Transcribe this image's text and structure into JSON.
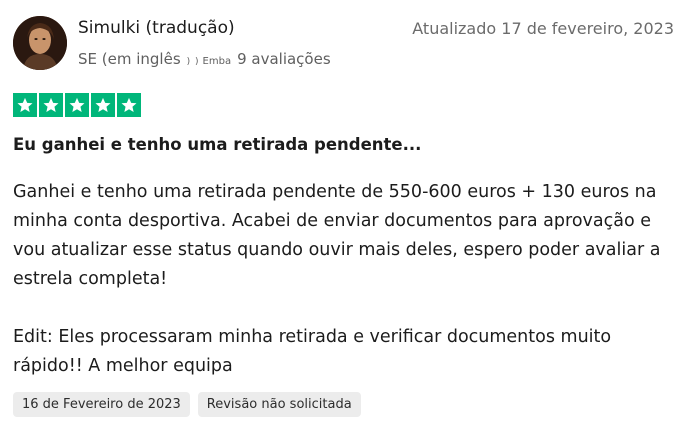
{
  "review": {
    "author": "Simulki (tradução)",
    "updated": "Atualizado 17 de fevereiro, 2023",
    "country": "SE (em inglês",
    "separator": ") )",
    "emba_label": "Emba",
    "review_count": "9 avaliações",
    "rating": 5,
    "rating_color": "#00b67a",
    "title": "Eu ganhei e tenho uma retirada pendente...",
    "body_paragraphs": [
      "Ganhei e tenho uma retirada pendente de 550-600 euros + 130 euros na minha conta desportiva. Acabei de enviar documentos para aprovação e vou atualizar esse status quando ouvir mais deles, espero poder avaliar a estrela completa!",
      "Edit: Eles processaram minha retirada e verificar documentos muito rápido!! A melhor equipa"
    ],
    "tags": [
      "16 de Fevereiro de 2023",
      "Revisão não solicitada"
    ]
  }
}
